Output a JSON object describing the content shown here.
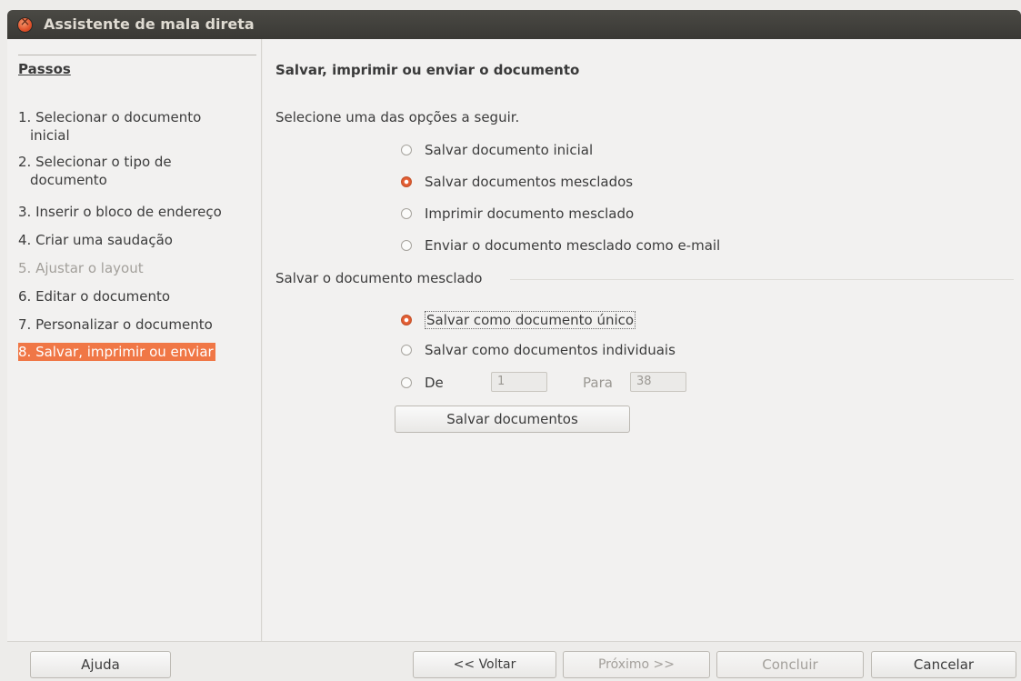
{
  "window": {
    "title": "Assistente de mala direta"
  },
  "sidebar": {
    "title": "Passos",
    "steps": [
      {
        "label_line1": "1. Selecionar o documento",
        "label_line2": "inicial"
      },
      {
        "label_line1": "2. Selecionar o tipo de",
        "label_line2": "documento"
      },
      {
        "label": "3. Inserir o bloco de endereço"
      },
      {
        "label": "4. Criar uma saudação"
      },
      {
        "label": "5. Ajustar o layout"
      },
      {
        "label": "6. Editar o documento"
      },
      {
        "label": "7. Personalizar o documento"
      },
      {
        "label": "8. Salvar, imprimir ou enviar"
      }
    ]
  },
  "main": {
    "heading": "Salvar, imprimir ou enviar o documento",
    "instruction": "Selecione uma das opções a seguir.",
    "options": [
      {
        "label": "Salvar documento inicial",
        "checked": false
      },
      {
        "label": "Salvar documentos mesclados",
        "checked": true
      },
      {
        "label": "Imprimir documento mesclado",
        "checked": false
      },
      {
        "label": "Enviar o documento mesclado como e-mail",
        "checked": false
      }
    ],
    "merged_section": {
      "label": "Salvar o documento mesclado",
      "options": [
        {
          "label": "Salvar como documento único",
          "checked": true
        },
        {
          "label": "Salvar como documentos individuais",
          "checked": false
        }
      ],
      "range": {
        "from_label": "De",
        "from_value": "1",
        "to_label": "Para",
        "to_value": "38"
      },
      "save_button": "Salvar documentos"
    }
  },
  "footer": {
    "help": "Ajuda",
    "back": "<< Voltar",
    "next": "Próximo >>",
    "finish": "Concluir",
    "cancel": "Cancelar"
  },
  "colors": {
    "accent": "#f07746",
    "titlebar": "#3c3b37"
  }
}
